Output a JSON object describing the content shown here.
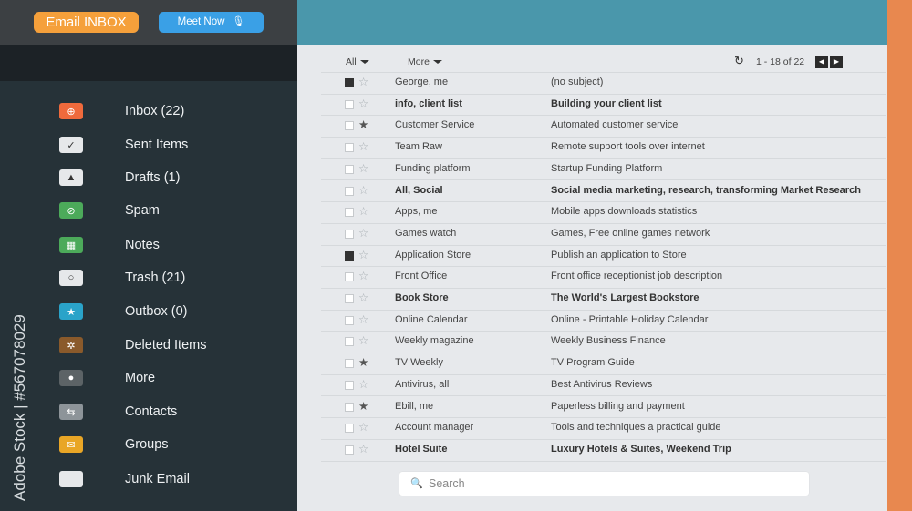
{
  "header": {
    "app_title": "Email INBOX",
    "meet_button_label": "Meet Now",
    "mic_icon": "microphone-icon"
  },
  "sidebar": {
    "items": [
      {
        "label": "Inbox (22)",
        "icon": "inbox-icon",
        "color": "#ef6a3c",
        "glyph": "⊕"
      },
      {
        "label": "Sent Items",
        "icon": "checkmark-icon",
        "color": "#e6e8ea",
        "glyph": "✓"
      },
      {
        "label": "Drafts (1)",
        "icon": "bell-icon",
        "color": "#e6e8ea",
        "glyph": "▲"
      },
      {
        "label": "Spam",
        "icon": "spam-icon",
        "color": "#4caa5a",
        "glyph": "⊘"
      },
      {
        "label": "Notes",
        "icon": "grid-icon",
        "color": "#4caa5a",
        "glyph": "▦"
      },
      {
        "label": "Trash (21)",
        "icon": "circle-icon",
        "color": "#e6e8ea",
        "glyph": "○"
      },
      {
        "label": "Outbox (0)",
        "icon": "star-icon",
        "color": "#2aa3c9",
        "glyph": "★"
      },
      {
        "label": "Deleted Items",
        "icon": "gear-icon",
        "color": "#8a5a2b",
        "glyph": "✲"
      },
      {
        "label": "More",
        "icon": "people-icon",
        "color": "#5c6366",
        "glyph": "●"
      },
      {
        "label": "Contacts",
        "icon": "arrows-icon",
        "color": "#8d9499",
        "glyph": "⇆"
      },
      {
        "label": "Groups",
        "icon": "envelope-icon",
        "color": "#e9a626",
        "glyph": "✉"
      },
      {
        "label": "Junk Email",
        "icon": "blank-icon",
        "color": "#e6e8ea",
        "glyph": ""
      }
    ],
    "stock_id": "Adobe Stock | #567078029"
  },
  "toolbar": {
    "all_label": "All",
    "more_label": "More",
    "page_count": "1 - 18 of 22",
    "refresh_icon": "refresh-icon",
    "prev_icon": "chevron-left-icon",
    "next_icon": "chevron-right-icon"
  },
  "emails": [
    {
      "sender": "George, me",
      "subject": "(no subject)",
      "checked": true,
      "starred": false,
      "bold": false
    },
    {
      "sender": "info, client list",
      "subject": "Building your client list",
      "checked": false,
      "starred": false,
      "bold": true
    },
    {
      "sender": "Customer Service",
      "subject": "Automated customer service",
      "checked": false,
      "starred": true,
      "bold": false
    },
    {
      "sender": "Team Raw",
      "subject": "Remote support tools over internet",
      "checked": false,
      "starred": false,
      "bold": false
    },
    {
      "sender": "Funding platform",
      "subject": "Startup Funding Platform",
      "checked": false,
      "starred": false,
      "bold": false
    },
    {
      "sender": "All, Social",
      "subject": "Social media marketing, research, transforming Market Research",
      "checked": false,
      "starred": false,
      "bold": true
    },
    {
      "sender": "Apps, me",
      "subject": "Mobile apps downloads statistics",
      "checked": false,
      "starred": false,
      "bold": false
    },
    {
      "sender": "Games watch",
      "subject": "Games, Free online games network",
      "checked": false,
      "starred": false,
      "bold": false
    },
    {
      "sender": "Application Store",
      "subject": "Publish an application to Store",
      "checked": true,
      "starred": false,
      "bold": false
    },
    {
      "sender": "Front Office",
      "subject": "Front office receptionist job description",
      "checked": false,
      "starred": false,
      "bold": false
    },
    {
      "sender": "Book Store",
      "subject": "The World's Largest  Bookstore",
      "checked": false,
      "starred": false,
      "bold": true
    },
    {
      "sender": "Online Calendar",
      "subject": "Online - Printable Holiday Calendar",
      "checked": false,
      "starred": false,
      "bold": false
    },
    {
      "sender": "Weekly magazine",
      "subject": "Weekly Business Finance",
      "checked": false,
      "starred": false,
      "bold": false
    },
    {
      "sender": "TV Weekly",
      "subject": "TV Program Guide",
      "checked": false,
      "starred": true,
      "bold": false
    },
    {
      "sender": "Antivirus, all",
      "subject": "Best Antivirus Reviews",
      "checked": false,
      "starred": false,
      "bold": false
    },
    {
      "sender": "Ebill, me",
      "subject": "Paperless billing and payment",
      "checked": false,
      "starred": true,
      "bold": false
    },
    {
      "sender": "Account manager",
      "subject": "Tools and techniques a practical guide",
      "checked": false,
      "starred": false,
      "bold": false
    },
    {
      "sender": "Hotel Suite",
      "subject": "Luxury Hotels & Suites, Weekend Trip",
      "checked": false,
      "starred": false,
      "bold": true
    }
  ],
  "search": {
    "placeholder": "Search",
    "value": ""
  },
  "colors": {
    "sidebar_bg": "#263238",
    "banner": "#4a97ab",
    "accent_orange": "#f5a03b",
    "meet_blue": "#3aa0e6",
    "right_strip": "#e8884f"
  }
}
